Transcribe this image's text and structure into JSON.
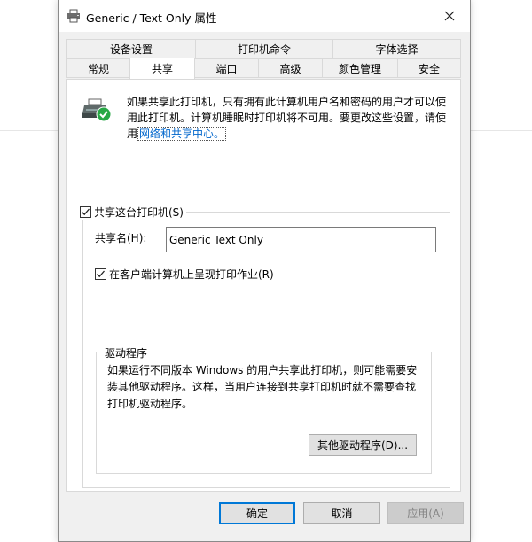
{
  "window": {
    "title": "Generic / Text Only 属性",
    "close_glyph": "✕"
  },
  "tabs_row1": [
    {
      "label": "设备设置"
    },
    {
      "label": "打印机命令"
    },
    {
      "label": "字体选择"
    }
  ],
  "tabs_row2": [
    {
      "label": "常规"
    },
    {
      "label": "共享",
      "active": true
    },
    {
      "label": "端口"
    },
    {
      "label": "高级"
    },
    {
      "label": "颜色管理"
    },
    {
      "label": "安全"
    }
  ],
  "sharing": {
    "info_text": "如果共享此打印机，只有拥有此计算机用户名和密码的用户才可以使用此打印机。计算机睡眠时打印机将不可用。要更改这些设置，请使用",
    "info_link": "网络和共享中心。",
    "share_checkbox_label": "共享这台打印机(S)",
    "share_checked": true,
    "share_name_label": "共享名(H):",
    "share_name_value": "Generic  Text Only",
    "render_checkbox_label": "在客户端计算机上呈现打印作业(R)",
    "render_checked": true
  },
  "drivers": {
    "legend": "驱动程序",
    "text": "如果运行不同版本 Windows 的用户共享此打印机，则可能需要安装其他驱动程序。这样，当用户连接到共享打印机时就不需要查找打印机驱动程序。",
    "button_label": "其他驱动程序(D)..."
  },
  "buttons": {
    "ok": "确定",
    "cancel": "取消",
    "apply": "应用(A)"
  },
  "colors": {
    "link": "#0066cc",
    "focus_border": "#0078d7",
    "check_badge": "#27a745"
  }
}
